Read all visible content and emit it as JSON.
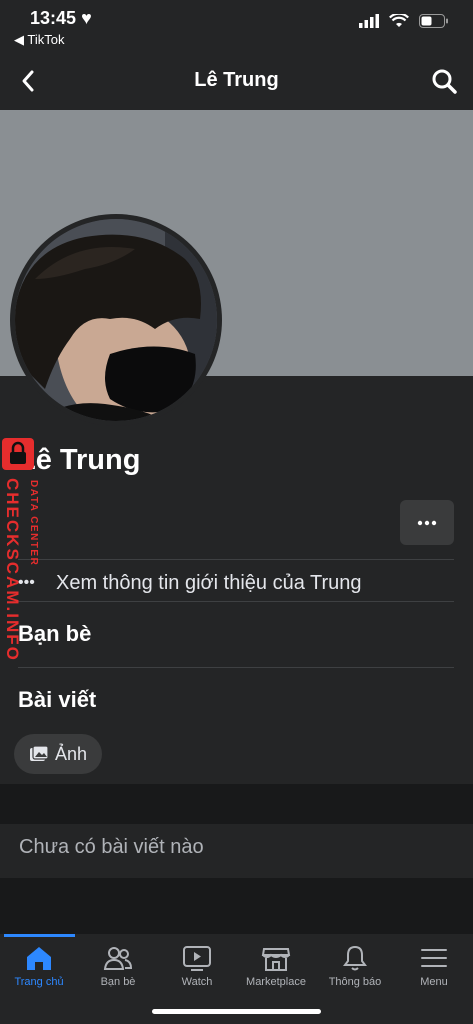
{
  "status_bar": {
    "time": "13:45",
    "back_app": "◀ TikTok"
  },
  "nav": {
    "title": "Lê Trung"
  },
  "profile": {
    "name": "Lê Trung",
    "about_link": "Xem thông tin giới thiệu của Trung"
  },
  "sections": {
    "friends_title": "Bạn bè",
    "posts_title": "Bài viết",
    "photos_chip": "Ảnh",
    "empty_posts": "Chưa có bài viết nào"
  },
  "tabbar": {
    "items": [
      {
        "label": "Trang chủ",
        "icon": "home-icon",
        "active": true
      },
      {
        "label": "Bạn bè",
        "icon": "friends-icon",
        "active": false
      },
      {
        "label": "Watch",
        "icon": "watch-icon",
        "active": false
      },
      {
        "label": "Marketplace",
        "icon": "marketplace-icon",
        "active": false
      },
      {
        "label": "Thông báo",
        "icon": "bell-icon",
        "active": false
      },
      {
        "label": "Menu",
        "icon": "menu-icon",
        "active": false
      }
    ]
  },
  "watermark": {
    "main": "CHECKSCAM.INFO",
    "sub": "DATA CENTER"
  },
  "colors": {
    "accent": "#2d88ff",
    "background": "#18191a",
    "card": "#242526",
    "watermark": "#e62d2d"
  }
}
